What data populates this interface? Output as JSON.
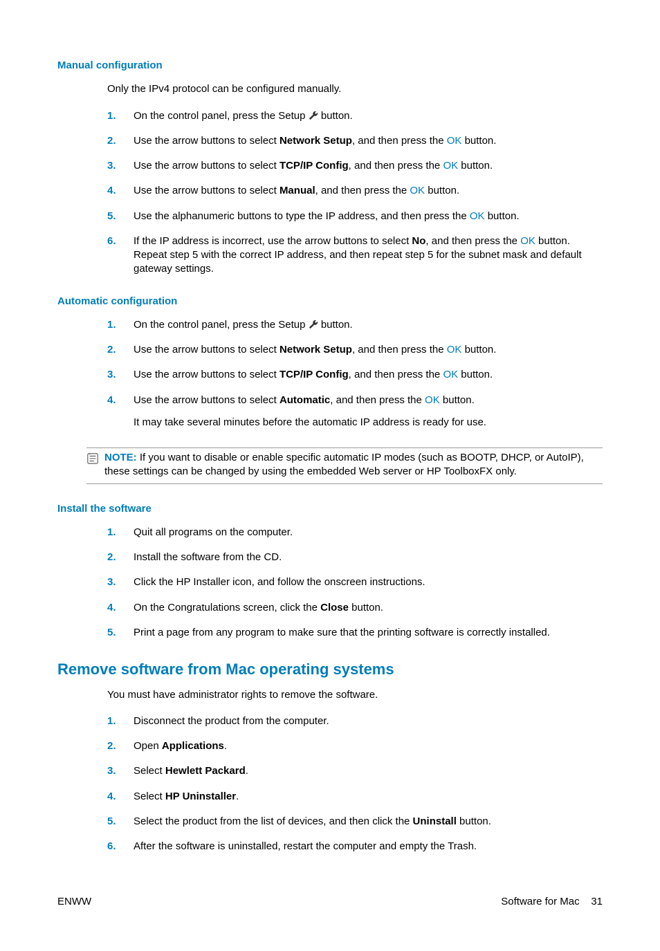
{
  "sec1": {
    "heading": "Manual configuration",
    "intro": "Only the IPv4 protocol can be configured manually.",
    "steps": [
      {
        "n": "1.",
        "pre": "On the control panel, press the Setup ",
        "icon": "wrench",
        "post": " button."
      },
      {
        "n": "2.",
        "parts": [
          "Use the arrow buttons to select ",
          {
            "b": "Network Setup"
          },
          ", and then press the ",
          {
            "ok": "OK"
          },
          " button."
        ]
      },
      {
        "n": "3.",
        "parts": [
          "Use the arrow buttons to select ",
          {
            "b": "TCP/IP Config"
          },
          ", and then press the ",
          {
            "ok": "OK"
          },
          " button."
        ]
      },
      {
        "n": "4.",
        "parts": [
          "Use the arrow buttons to select ",
          {
            "b": "Manual"
          },
          ", and then press the ",
          {
            "ok": "OK"
          },
          " button."
        ]
      },
      {
        "n": "5.",
        "parts": [
          "Use the alphanumeric buttons to type the IP address, and then press the ",
          {
            "ok": "OK"
          },
          " button."
        ]
      },
      {
        "n": "6.",
        "parts": [
          "If the IP address is incorrect, use the arrow buttons to select ",
          {
            "b": "No"
          },
          ", and then press the ",
          {
            "ok": "OK"
          },
          " button. Repeat step 5 with the correct IP address, and then repeat step 5 for the subnet mask and default gateway settings."
        ]
      }
    ]
  },
  "sec2": {
    "heading": "Automatic configuration",
    "steps": [
      {
        "n": "1.",
        "pre": "On the control panel, press the Setup ",
        "icon": "wrench",
        "post": " button."
      },
      {
        "n": "2.",
        "parts": [
          "Use the arrow buttons to select ",
          {
            "b": "Network Setup"
          },
          ", and then press the ",
          {
            "ok": "OK"
          },
          " button."
        ]
      },
      {
        "n": "3.",
        "parts": [
          "Use the arrow buttons to select ",
          {
            "b": "TCP/IP Config"
          },
          ", and then press the ",
          {
            "ok": "OK"
          },
          " button."
        ]
      },
      {
        "n": "4.",
        "parts": [
          "Use the arrow buttons to select ",
          {
            "b": "Automatic"
          },
          ", and then press the ",
          {
            "ok": "OK"
          },
          " button."
        ],
        "after": "It may take several minutes before the automatic IP address is ready for use."
      }
    ],
    "note_label": "NOTE:",
    "note_text": "If you want to disable or enable specific automatic IP modes (such as BOOTP, DHCP, or AutoIP), these settings can be changed by using the embedded Web server or HP ToolboxFX only."
  },
  "sec3": {
    "heading": "Install the software",
    "steps": [
      {
        "n": "1.",
        "parts": [
          "Quit all programs on the computer."
        ]
      },
      {
        "n": "2.",
        "parts": [
          "Install the software from the CD."
        ]
      },
      {
        "n": "3.",
        "parts": [
          "Click the HP Installer icon, and follow the onscreen instructions."
        ]
      },
      {
        "n": "4.",
        "parts": [
          "On the Congratulations screen, click the ",
          {
            "b": "Close"
          },
          " button."
        ]
      },
      {
        "n": "5.",
        "parts": [
          "Print a page from any program to make sure that the printing software is correctly installed."
        ]
      }
    ]
  },
  "sec4": {
    "heading": "Remove software from Mac operating systems",
    "intro": "You must have administrator rights to remove the software.",
    "steps": [
      {
        "n": "1.",
        "parts": [
          "Disconnect the product from the computer."
        ]
      },
      {
        "n": "2.",
        "parts": [
          "Open ",
          {
            "b": "Applications"
          },
          "."
        ]
      },
      {
        "n": "3.",
        "parts": [
          "Select ",
          {
            "b": "Hewlett Packard"
          },
          "."
        ]
      },
      {
        "n": "4.",
        "parts": [
          "Select ",
          {
            "b": "HP Uninstaller"
          },
          "."
        ]
      },
      {
        "n": "5.",
        "parts": [
          "Select the product from the list of devices, and then click the ",
          {
            "b": "Uninstall"
          },
          " button."
        ]
      },
      {
        "n": "6.",
        "parts": [
          "After the software is uninstalled, restart the computer and empty the Trash."
        ]
      }
    ]
  },
  "footer": {
    "left": "ENWW",
    "right_label": "Software for Mac",
    "page": "31"
  }
}
